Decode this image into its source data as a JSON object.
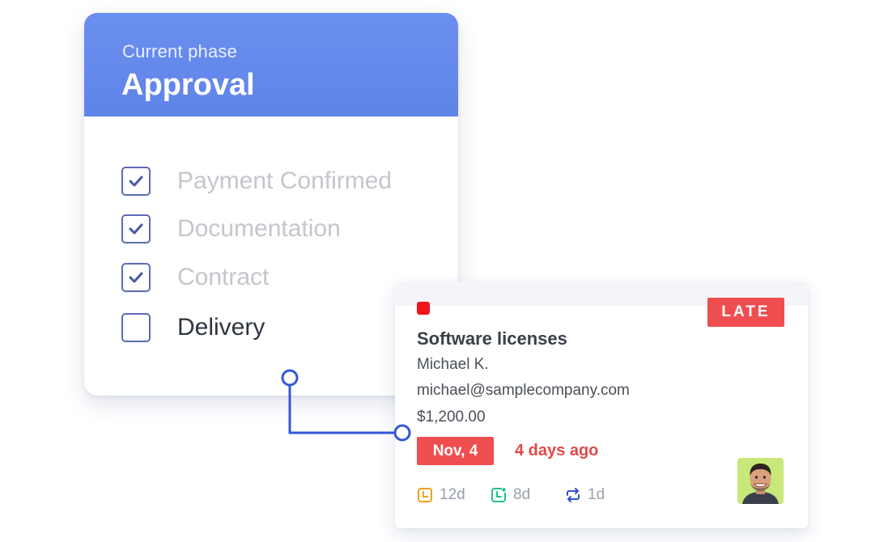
{
  "phase_card": {
    "label": "Current phase",
    "title": "Approval",
    "checklist": [
      {
        "label": "Payment Confirmed",
        "checked": true
      },
      {
        "label": "Documentation",
        "checked": true
      },
      {
        "label": "Contract",
        "checked": true
      },
      {
        "label": "Delivery",
        "checked": false
      }
    ]
  },
  "deal_card": {
    "badge": "LATE",
    "title": "Software licenses",
    "contact_name": "Michael K.",
    "email": "michael@samplecompany.com",
    "amount": "$1,200.00",
    "due_date": "Nov, 4",
    "relative_time": "4 days ago",
    "stats": [
      {
        "icon": "clock-icon",
        "value": "12d",
        "color": "#f0a020"
      },
      {
        "icon": "clock-alert-icon",
        "value": "8d",
        "color": "#1fbf8f"
      },
      {
        "icon": "repeat-icon",
        "value": "1d",
        "color": "#3050d8"
      }
    ]
  },
  "colors": {
    "header_blue": "#6387eb",
    "checkbox_border": "#5c6bb4",
    "connector_blue": "#3358d6",
    "late_red": "#ef4e50",
    "marker_red": "#f2141b"
  }
}
